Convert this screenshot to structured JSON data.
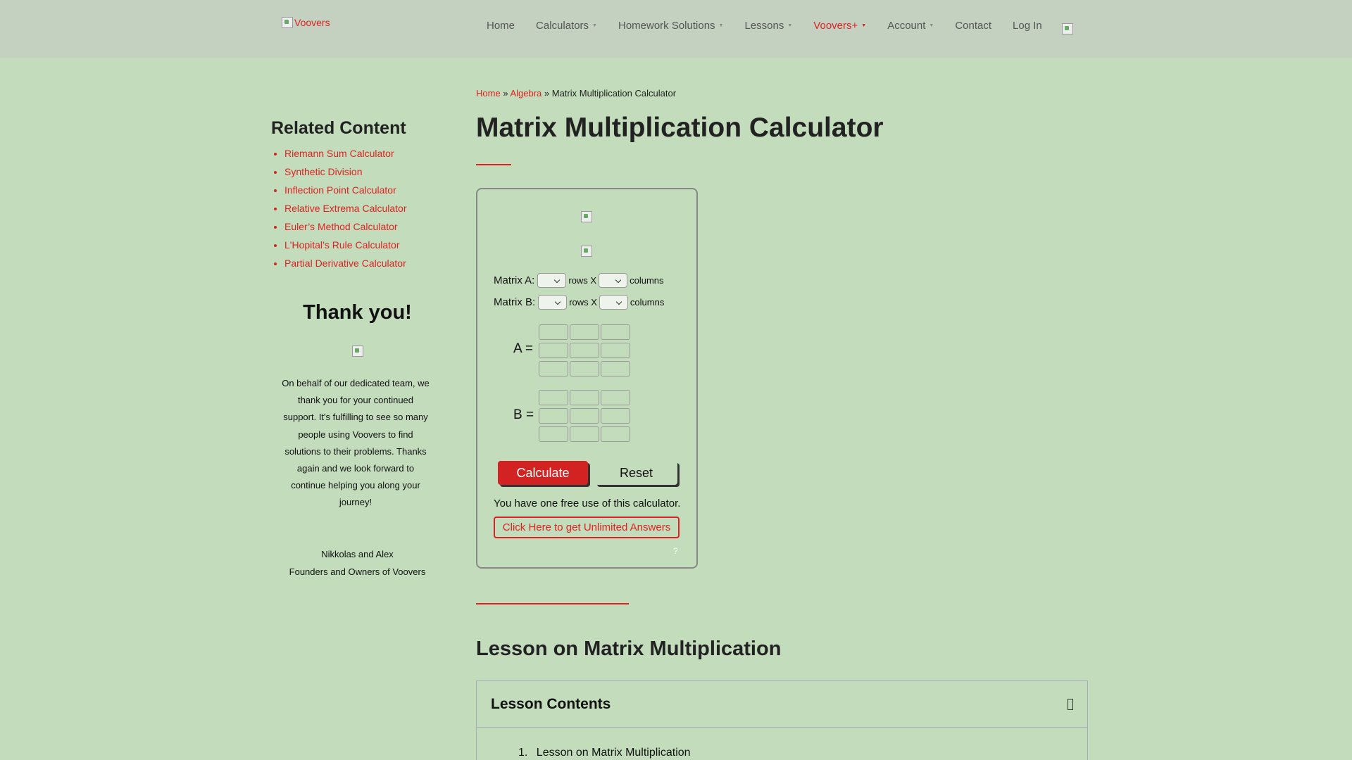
{
  "header": {
    "logo_alt": "Voovers",
    "nav": [
      {
        "label": "Home",
        "has_dropdown": false
      },
      {
        "label": "Calculators",
        "has_dropdown": true
      },
      {
        "label": "Homework Solutions",
        "has_dropdown": true
      },
      {
        "label": "Lessons",
        "has_dropdown": true
      },
      {
        "label": "Voovers+",
        "has_dropdown": true
      },
      {
        "label": "Account",
        "has_dropdown": true
      },
      {
        "label": "Contact",
        "has_dropdown": false
      },
      {
        "label": "Log In",
        "has_dropdown": false
      }
    ]
  },
  "breadcrumb": {
    "home": "Home",
    "sep": "»",
    "category": "Algebra",
    "current": "Matrix Multiplication Calculator"
  },
  "page_title": "Matrix Multiplication Calculator",
  "sidebar": {
    "related_title": "Related Content",
    "related": [
      "Riemann Sum Calculator",
      "Synthetic Division",
      "Inflection Point Calculator",
      "Relative Extrema Calculator",
      "Euler’s Method Calculator",
      "L'Hopital’s Rule Calculator",
      "Partial Derivative Calculator"
    ],
    "thanks_title": "Thank you!",
    "thanks_body": "On behalf of our dedicated team, we thank you for your continued support. It's fulfilling to see so many people using Voovers to find solutions to their problems. Thanks again and we look forward to continue helping you along your journey!",
    "sign_names": "Nikkolas and Alex",
    "sign_role": "Founders and Owners of Voovers"
  },
  "calculator": {
    "matrix_a_label": "Matrix A:",
    "matrix_b_label": "Matrix B:",
    "rows_x": "rows X",
    "columns": "columns",
    "a_eq": "A =",
    "b_eq": "B =",
    "calculate": "Calculate",
    "reset": "Reset",
    "free_note": "You have one free use of this calculator.",
    "unlimited": "Click Here to get Unlimited Answers",
    "help": "?"
  },
  "lesson": {
    "title": "Lesson on Matrix Multiplication",
    "contents_title": "Lesson Contents",
    "items": [
      {
        "num": "1.",
        "label": "Lesson on Matrix Multiplication"
      }
    ]
  },
  "colors": {
    "accent": "#d32222",
    "background": "#c3dcbc",
    "header": "#c4d1c1"
  }
}
